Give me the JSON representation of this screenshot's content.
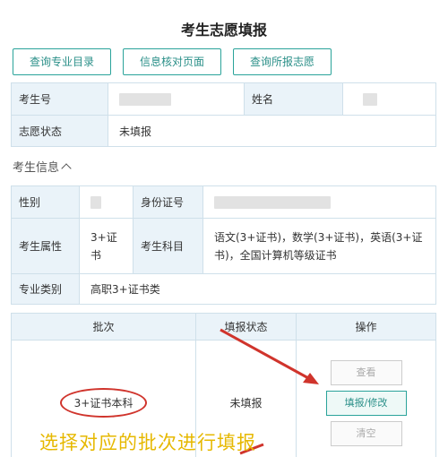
{
  "title": "考生志愿填报",
  "toolbar": {
    "btn1": "查询专业目录",
    "btn2": "信息核对页面",
    "btn3": "查询所报志愿"
  },
  "top_table": {
    "exam_no_label": "考生号",
    "name_label": "姓名",
    "status_label": "志愿状态",
    "status_value": "未填报"
  },
  "section": {
    "title": "考生信息"
  },
  "info": {
    "gender_label": "性别",
    "id_label": "身份证号",
    "attr_label": "考生属性",
    "attr_value": "3+证书",
    "subjects_label": "考生科目",
    "subjects_value": "语文(3+证书)，数学(3+证书)，英语(3+证书)，全国计算机等级证书",
    "category_label": "专业类别",
    "category_value": "高职3+证书类"
  },
  "batch_table": {
    "headers": [
      "批次",
      "填报状态",
      "操作"
    ],
    "row": {
      "batch": "3+证书本科",
      "status": "未填报",
      "view": "查看",
      "fill": "填报/修改",
      "clear": "清空"
    }
  },
  "overlay_text": "选择对应的批次进行填报",
  "colors": {
    "accent": "#2aa39a",
    "annotation": "#d0342c",
    "overlay": "#e6b800"
  }
}
